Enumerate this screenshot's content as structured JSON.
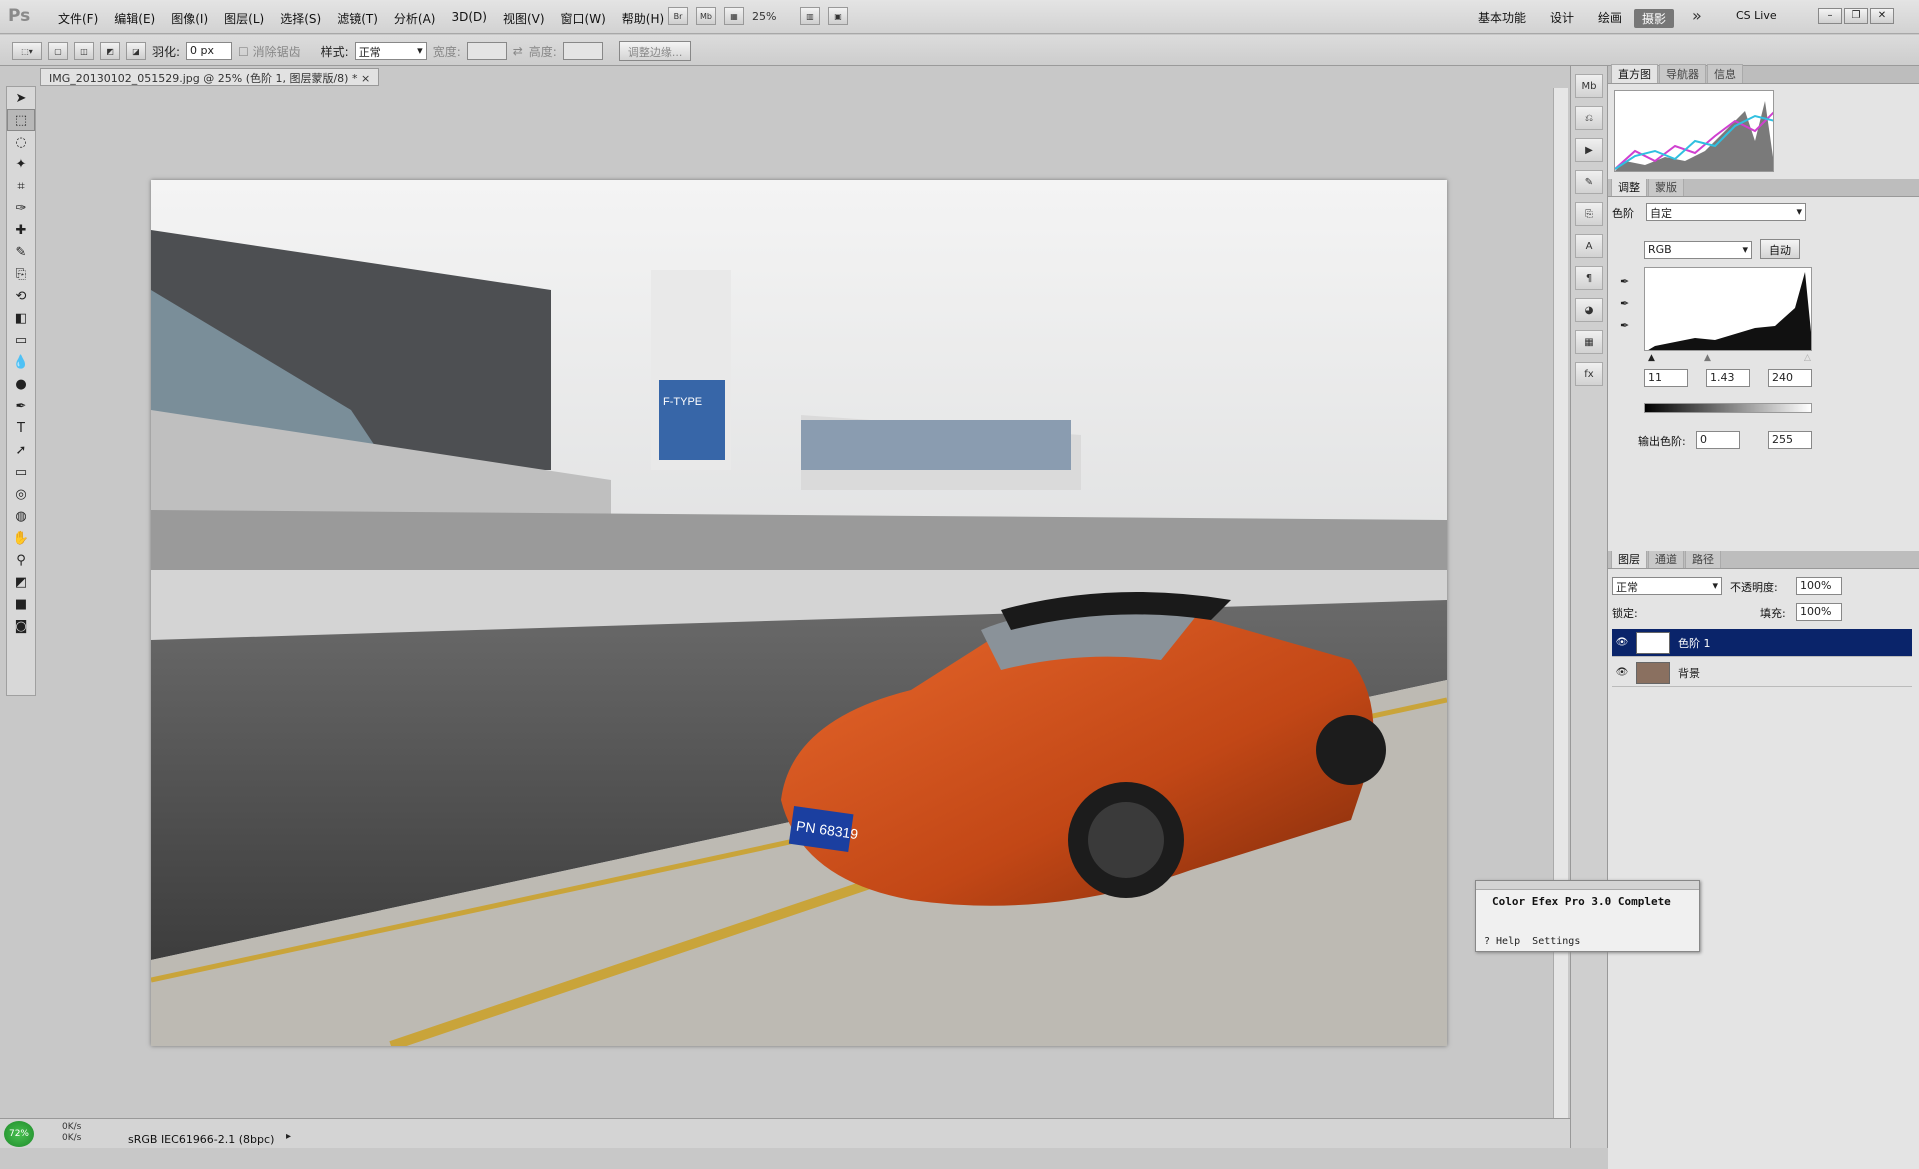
{
  "app": {
    "logo": "Ps"
  },
  "menu": [
    "文件(F)",
    "编辑(E)",
    "图像(I)",
    "图层(L)",
    "选择(S)",
    "滤镜(T)",
    "分析(A)",
    "3D(D)",
    "视图(V)",
    "窗口(W)",
    "帮助(H)"
  ],
  "app_bar": {
    "br": "Br",
    "mb": "Mb",
    "zoom": "25%"
  },
  "workspaces": [
    "基本功能",
    "设计",
    "绘画",
    "摄影"
  ],
  "workspace_active": "摄影",
  "more_ws": "»",
  "cs_live": "CS Live",
  "options_bar": {
    "feather_label": "羽化:",
    "feather_value": "0 px",
    "antialias_label": "消除锯齿",
    "style_label": "样式:",
    "style_value": "正常",
    "width_label": "宽度:",
    "height_label": "高度:",
    "refine_edge": "调整边缘..."
  },
  "document": {
    "tab_title": "IMG_20130102_051529.jpg @ 25% (色阶 1, 图层蒙版/8) *",
    "close": "×"
  },
  "status": {
    "zoom": "72%",
    "speed_up": "0K/s",
    "speed_down": "0K/s",
    "profile": "sRGB IEC61966-2.1 (8bpc)"
  },
  "panels": {
    "histogram_tabs": [
      "直方图",
      "导航器",
      "信息"
    ],
    "adjust_tabs": [
      "调整",
      "蒙版"
    ],
    "levels_label": "色阶",
    "preset_value": "自定",
    "channel_value": "RGB",
    "auto_button": "自动",
    "input_black": "11",
    "input_gamma": "1.43",
    "input_white": "240",
    "output_label": "输出色阶:",
    "output_black": "0",
    "output_white": "255",
    "layers_tabs": [
      "图层",
      "通道",
      "路径"
    ],
    "blend_mode": "正常",
    "opacity_label": "不透明度:",
    "opacity_value": "100%",
    "lock_label": "锁定:",
    "fill_label": "填充:",
    "fill_value": "100%",
    "layers": [
      {
        "name": "色阶 1",
        "selected": true
      },
      {
        "name": "背景",
        "selected": false
      }
    ]
  },
  "plugin": {
    "title": "Color Efex Pro 3.0 Complete",
    "help": "? Help",
    "settings": "Settings"
  },
  "photo": {
    "plate": "PN 68319",
    "banner": "F-TYPE"
  }
}
